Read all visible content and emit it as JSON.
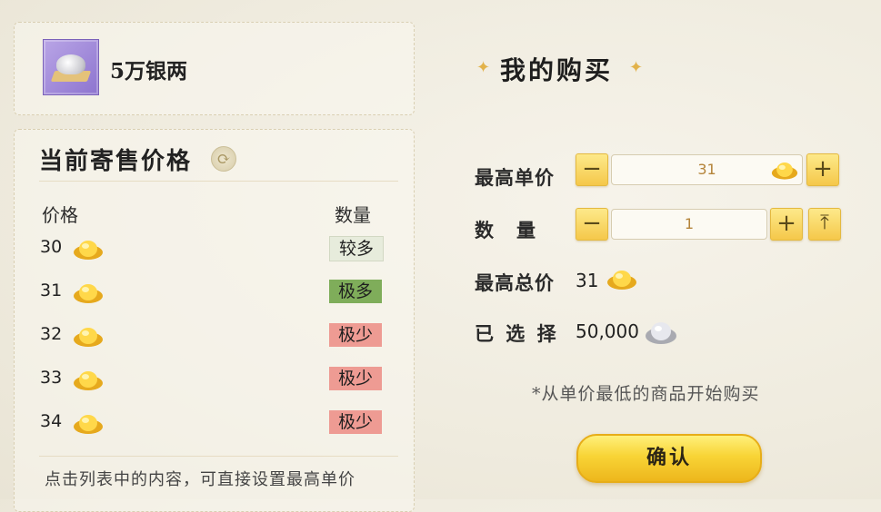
{
  "item": {
    "name": "5万银两",
    "icon": "silver-ingot-icon"
  },
  "listing": {
    "title": "当前寄售价格",
    "col_price": "价格",
    "col_qty": "数量",
    "rows": [
      {
        "price": "30",
        "qty": "较多",
        "status": "lots"
      },
      {
        "price": "31",
        "qty": "极多",
        "status": "many"
      },
      {
        "price": "32",
        "qty": "极少",
        "status": "few"
      },
      {
        "price": "33",
        "qty": "极少",
        "status": "few"
      },
      {
        "price": "34",
        "qty": "极少",
        "status": "few"
      }
    ],
    "footer_tip": "点击列表中的内容，可直接设置最高单价"
  },
  "buy": {
    "title": "我的购买",
    "max_price_label": "最高单价",
    "max_price_value": "31",
    "qty_label": "数　量",
    "qty_value": "1",
    "total_label": "最高总价",
    "total_value": "31",
    "selected_label": "已 选 择",
    "selected_value": "50,000",
    "note": "*从单价最低的商品开始购买",
    "confirm_label": "确认",
    "minus": "−",
    "plus": "+",
    "max": "⤒",
    "star": "✦"
  },
  "colors": {
    "gold": "#f5c84a",
    "many": "#7fad5a",
    "few": "#ee9b93",
    "lots": "#e7ecdc"
  }
}
